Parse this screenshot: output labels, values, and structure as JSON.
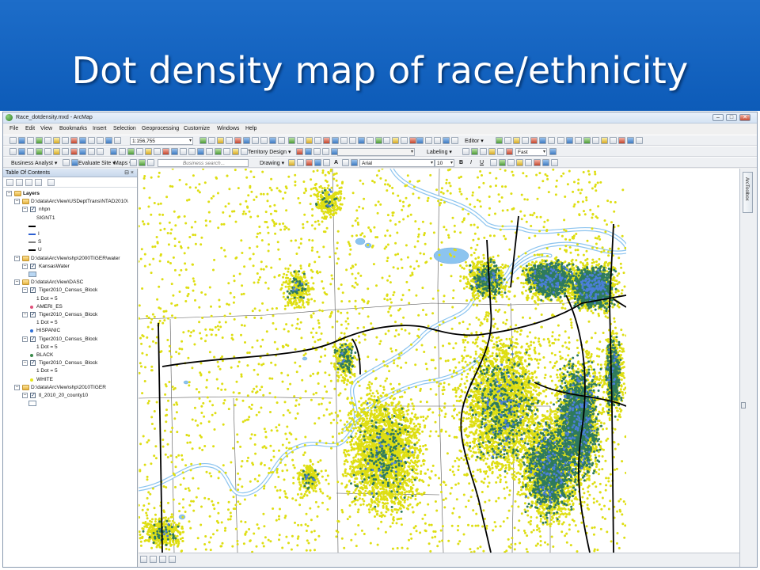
{
  "slide": {
    "title": "Dot density map of race/ethnicity"
  },
  "window": {
    "title": "Race_dotdensity.mxd - ArcMap",
    "controls": {
      "minimize": "–",
      "maximize": "□",
      "close": "✕"
    }
  },
  "menu": {
    "items": [
      "File",
      "Edit",
      "View",
      "Bookmarks",
      "Insert",
      "Selection",
      "Geoprocessing",
      "Customize",
      "Windows",
      "Help"
    ]
  },
  "toolbar1": {
    "scale_value": "1:156,755",
    "editor_label": "Editor ▾"
  },
  "toolbar2": {
    "territory_label": "Territory Design ▾",
    "labeling_label": "Labeling ▾",
    "quality_value": "Fast"
  },
  "toolbar3": {
    "business_analyst_label": "Business Analyst ▾",
    "evaluate_site_label": "Evaluate Site ▾",
    "maps_label": "Maps ▾",
    "search_placeholder": "Business search...",
    "drawing_label": "Drawing ▾",
    "font_name": "Arial",
    "font_size": "10",
    "bold": "B",
    "italic": "I",
    "underline": "U",
    "text_tool": "A"
  },
  "toc": {
    "title": "Table Of Contents",
    "controls": "⊟ ×",
    "rows": [
      {
        "indent": 0,
        "type": "group",
        "text": "Layers"
      },
      {
        "indent": 1,
        "type": "folder",
        "text": "D:\\data\\ArcView\\USDeptTrans\\NTAD2010\\"
      },
      {
        "indent": 2,
        "type": "layer",
        "text": "nhpn"
      },
      {
        "indent": 3,
        "type": "label",
        "text": "SIGNT1"
      },
      {
        "indent": 3,
        "type": "line",
        "text": "",
        "color": "#000000"
      },
      {
        "indent": 3,
        "type": "line",
        "text": "I",
        "color": "#2c5fd1"
      },
      {
        "indent": 3,
        "type": "line",
        "text": "S",
        "color": "#808080"
      },
      {
        "indent": 3,
        "type": "line",
        "text": "U",
        "color": "#000000"
      },
      {
        "indent": 1,
        "type": "folder",
        "text": "D:\\data\\ArcView\\shp\\2000TIGER\\water"
      },
      {
        "indent": 2,
        "type": "layer",
        "text": "KansasWater"
      },
      {
        "indent": 3,
        "type": "box",
        "text": "",
        "color": "#b9d7f3"
      },
      {
        "indent": 1,
        "type": "folder",
        "text": "D:\\data\\ArcView\\DASC"
      },
      {
        "indent": 2,
        "type": "layer",
        "text": "Tiger2010_Census_Block"
      },
      {
        "indent": 3,
        "type": "label",
        "text": "1 Dot = 5"
      },
      {
        "indent": 3,
        "type": "dot",
        "text": "AMERI_ES",
        "color": "#e0507a"
      },
      {
        "indent": 2,
        "type": "layer",
        "text": "Tiger2010_Census_Block"
      },
      {
        "indent": 3,
        "type": "label",
        "text": "1 Dot = 5"
      },
      {
        "indent": 3,
        "type": "dot",
        "text": "HISPANIC",
        "color": "#2f6fd6"
      },
      {
        "indent": 2,
        "type": "layer",
        "text": "Tiger2010_Census_Block"
      },
      {
        "indent": 3,
        "type": "label",
        "text": "1 Dot = 5"
      },
      {
        "indent": 3,
        "type": "dot",
        "text": "BLACK",
        "color": "#3a8a4a"
      },
      {
        "indent": 2,
        "type": "layer",
        "text": "Tiger2010_Census_Block"
      },
      {
        "indent": 3,
        "type": "label",
        "text": "1 Dot = 5"
      },
      {
        "indent": 3,
        "type": "dot",
        "text": "WHITE",
        "color": "#e6e61a"
      },
      {
        "indent": 1,
        "type": "folder",
        "text": "D:\\data\\ArcView\\shp\\2010TIGER"
      },
      {
        "indent": 2,
        "type": "layer",
        "text": "tl_2010_20_county10"
      },
      {
        "indent": 3,
        "type": "box",
        "text": "",
        "color": "#ffffff"
      }
    ]
  },
  "dock": {
    "arctoolbox_label": "ArcToolbox"
  },
  "map_colors": {
    "white_dots": "#dede12",
    "black_dots": "#2e7a5e",
    "hispanic_dots": "#4a7fd8",
    "water": "#8cc4ef",
    "roads": "#000000",
    "boundaries": "#555555"
  }
}
